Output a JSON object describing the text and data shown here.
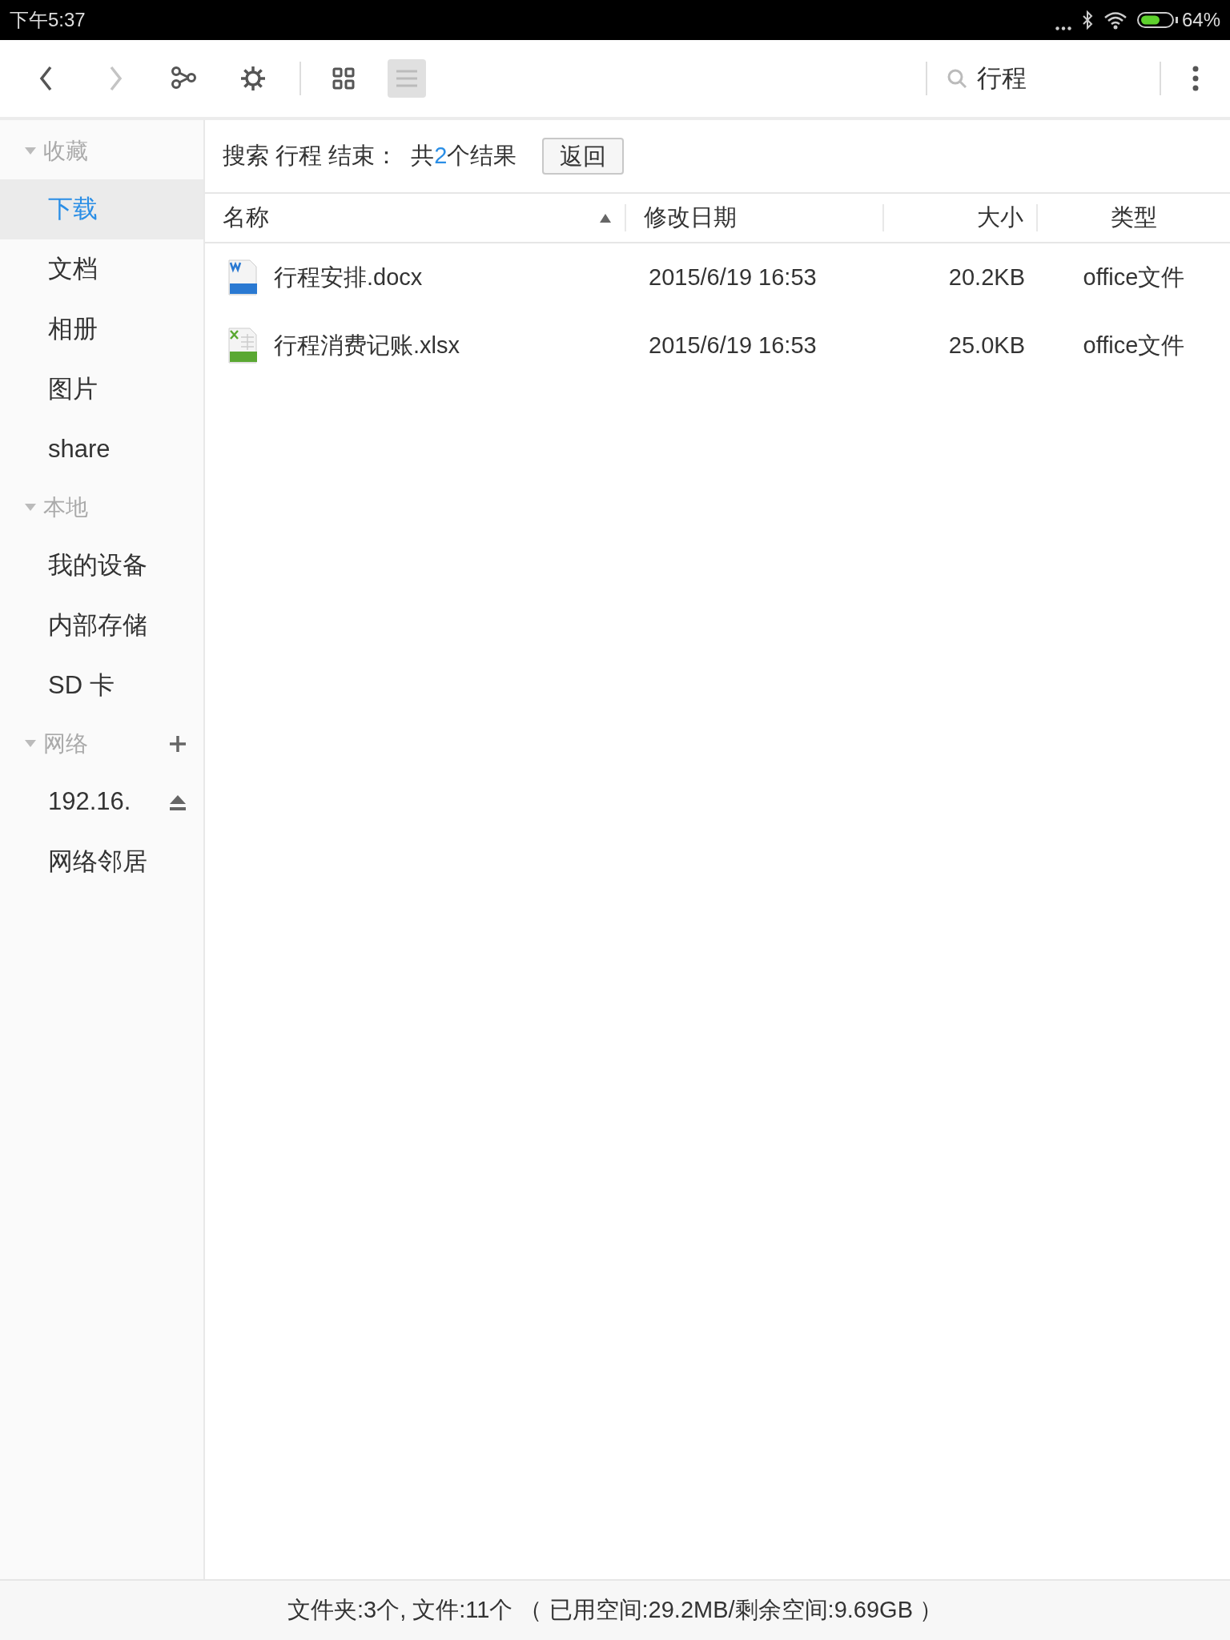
{
  "status_bar": {
    "time": "下午5:37",
    "battery": "64%"
  },
  "toolbar": {
    "nav": [
      {
        "kind": "back",
        "disabled": false
      },
      {
        "kind": "forward",
        "disabled": true
      }
    ],
    "tools": [
      {
        "kind": "share"
      },
      {
        "kind": "settings"
      }
    ],
    "views": [
      {
        "kind": "grid",
        "selected": false
      },
      {
        "kind": "list",
        "selected": true
      }
    ],
    "search": {
      "value": "行程"
    }
  },
  "sidebar": {
    "sections": [
      {
        "label": "收藏",
        "expanded": true,
        "items": [
          {
            "label": "下载",
            "selected": true
          },
          {
            "label": "文档",
            "selected": false
          },
          {
            "label": "相册",
            "selected": false
          },
          {
            "label": "图片",
            "selected": false
          },
          {
            "label": "share",
            "selected": false
          }
        ]
      },
      {
        "label": "本地",
        "expanded": true,
        "items": [
          {
            "label": "我的设备",
            "selected": false
          },
          {
            "label": "内部存储",
            "selected": false
          },
          {
            "label": "SD 卡",
            "selected": false
          }
        ]
      },
      {
        "label": "网络",
        "expanded": true,
        "addable": true,
        "items": [
          {
            "label": "192.16.",
            "selected": false,
            "kind": "mount"
          },
          {
            "label": "网络邻居",
            "selected": false
          }
        ]
      }
    ]
  },
  "search_result": {
    "prefix": "搜索 行程 结束：  共",
    "count": "2",
    "suffix": "个结果",
    "button": "返回"
  },
  "table": {
    "columns": [
      {
        "label": "名称",
        "sorted": true
      },
      {
        "label": "修改日期",
        "sorted": false
      },
      {
        "label": "大小",
        "sorted": false
      },
      {
        "label": "类型",
        "sorted": false
      }
    ],
    "rows": [
      {
        "kind": "docx",
        "name": "行程安排.docx",
        "date": "2015/6/19 16:53",
        "size": "20.2KB",
        "type": "office文件"
      },
      {
        "kind": "xlsx",
        "name": "行程消费记账.xlsx",
        "date": "2015/6/19 16:53",
        "size": "25.0KB",
        "type": "office文件"
      }
    ]
  },
  "footer": "文件夹:3个, 文件:11个 （ 已用空间:29.2MB/剩余空间:9.69GB ）"
}
